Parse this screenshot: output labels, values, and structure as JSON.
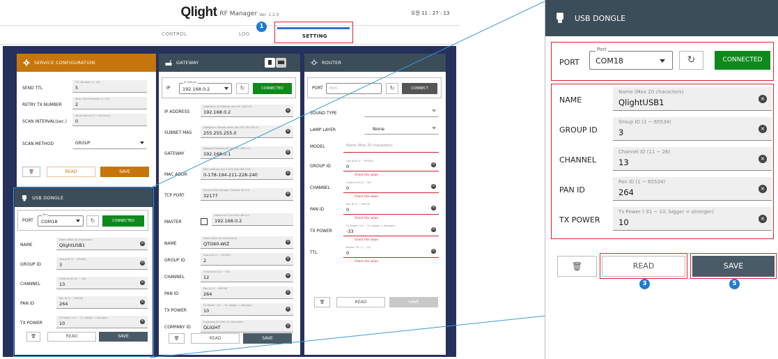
{
  "header": {
    "logo": "Qlight",
    "app_name": "RF Manager",
    "version": "Ver. 1.2.0",
    "clock": "오전 11 : 27 : 13"
  },
  "tabs": [
    {
      "label": "CONTROL"
    },
    {
      "label": "LOG"
    },
    {
      "label": "SETTING"
    }
  ],
  "service": {
    "title": "SERVICE CONFIGURATION",
    "fields": [
      {
        "label": "SEND TTL",
        "hint": "TTL Number (1~10)",
        "value": "5"
      },
      {
        "label": "RETRY TX NUMBER",
        "hint": "Retry Send Number (1~10)",
        "value": "2"
      },
      {
        "label": "SCAN INTERVAL(sec.)",
        "hint": "Send interval (0 = No Scan)",
        "value": "0"
      }
    ],
    "scan_method_label": "SCAN METHOD",
    "scan_method_value": "GROUP",
    "read_label": "READ",
    "save_label": "SAVE"
  },
  "usb": {
    "title": "USB DONGLE",
    "port_label": "PORT",
    "port_float": "Port",
    "port_value": "COM18",
    "connected_label": "CONNECTED",
    "fields": [
      {
        "label": "NAME",
        "hint": "Name (Max 20 characters)",
        "value": "QlightUSB1"
      },
      {
        "label": "GROUP ID",
        "hint": "Group ID (1 ~ 65534)",
        "value": "3"
      },
      {
        "label": "CHANNEL",
        "hint": "Channel ID (11 ~ 26)",
        "value": "13"
      },
      {
        "label": "PAN ID",
        "hint": "Pan ID (1 ~ 65534)",
        "value": "264"
      },
      {
        "label": "TX POWER",
        "hint": "Tx Power (-31 ~ 10, bigger = stronger)",
        "value": "10"
      }
    ],
    "read_label": "READ",
    "save_label": "SAVE"
  },
  "gateway": {
    "title": "GATEWAY",
    "ip_label": "IP",
    "ip_float": "IP Address",
    "ip_value": "192.168.0.2",
    "connected_label": "CONNECTED",
    "fields": [
      {
        "label": "IP ADDRESS",
        "hint": "Gateway's IP Address (ex:192.168.0.2)",
        "value": "192.168.0.2"
      },
      {
        "label": "SUBNET MAS",
        "hint": "Gateway's Subnet mask (ex:255.255.255.0)",
        "value": "255.255.255.0"
      },
      {
        "label": "GATEWAY",
        "hint": "Network Gateway IP (ex:192.168.0.1)",
        "value": "192.168.0.1"
      },
      {
        "label": "MAC ADDR",
        "hint": "MAC Address (ex:0-123-456-789-123)",
        "value": "0-178-194-211-228-240"
      },
      {
        "label": "TCP PORT",
        "hint": "Service Port (Integer, Default 32177)",
        "value": "32177"
      }
    ],
    "master_label": "MASTER",
    "master_hint": "Master's IP (ex:192.168.0.2)",
    "master_value": "192.168.0.2",
    "fields2": [
      {
        "label": "NAME",
        "hint": "Name (Max 20 characters)",
        "value": "QTG60-WIZ"
      },
      {
        "label": "GROUP ID",
        "hint": "Group ID (1 ~ 65534)",
        "value": "2"
      },
      {
        "label": "CHANNEL",
        "hint": "Channel ID (11 ~ 26)",
        "value": "12"
      },
      {
        "label": "PAN ID",
        "hint": "Pan ID (1 ~ 65534)",
        "value": "264"
      },
      {
        "label": "TX POWER",
        "hint": "Tx Power (-31 ~ 10, bigger = stronger)",
        "value": "10"
      },
      {
        "label": "COMPANY ID",
        "hint": "Company ID (Max 20 character)",
        "value": "QLIGHT"
      }
    ],
    "read_label": "READ",
    "save_label": "SAVE"
  },
  "router": {
    "title": "ROUTER",
    "port_label": "PORT",
    "port_placeholder": "Port",
    "connect_label": "CONNECT",
    "sound_type_label": "SOUND TYPE",
    "lamp_layer_label": "LAMP LAYER",
    "lamp_layer_value": "None",
    "model_label": "MODEL",
    "model_placeholder": "Name (Max 20 characters)",
    "fields": [
      {
        "label": "GROUP ID",
        "hint": "Group ID (1 ~ 65534)",
        "value": "0"
      },
      {
        "label": "CHANNEL",
        "hint": "Channel ID (1 ~ 26)",
        "value": "0"
      },
      {
        "label": "PAN ID",
        "hint": "Pan ID (1 ~ 65534)",
        "value": "0"
      },
      {
        "label": "TX POWER",
        "hint": "Tx Power (-31 ~ 10, bigger = stronger)",
        "value": "-33"
      },
      {
        "label": "TTL",
        "hint": "Router TTL (1 ~ 10)",
        "value": "0"
      }
    ],
    "check_msg": "Check the value.",
    "read_label": "READ",
    "save_label": "SAVE"
  },
  "badges": {
    "one": "1",
    "three": "3",
    "five": "5"
  },
  "colors": {
    "background": "#26305d",
    "service_header": "#c6760c",
    "panel_header": "#3b4d58",
    "connected": "#0d8a1b",
    "highlight": "#e02030",
    "badge": "#1e7bd0"
  }
}
